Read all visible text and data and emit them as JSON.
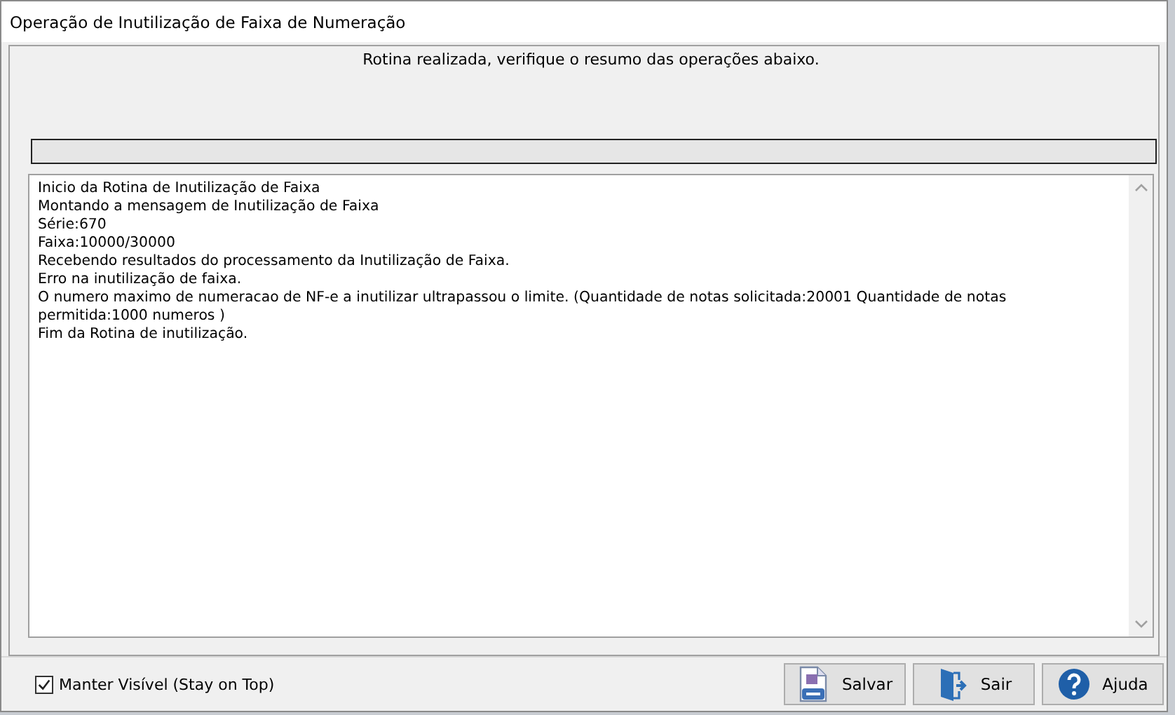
{
  "window": {
    "title": "Operação de Inutilização de Faixa de Numeração"
  },
  "status_message": "Rotina realizada, verifique o resumo das operações abaixo.",
  "progress": {
    "level": 0
  },
  "log_lines": [
    "Inicio da Rotina de Inutilização de Faixa",
    "Montando a mensagem de Inutilização de Faixa",
    "Série:670",
    "Faixa:10000/30000",
    "Recebendo resultados do processamento da Inutilização de Faixa.",
    "Erro na inutilização de faixa.",
    "O numero maximo de numeracao de NF-e a inutilizar ultrapassou o limite. (Quantidade de notas solicitada:20001 Quantidade de notas permitida:1000 numeros )",
    "Fim da Rotina de inutilização."
  ],
  "stay_on_top": {
    "label": "Manter Visível (Stay on Top)",
    "checked": true
  },
  "buttons": [
    {
      "kind": "save",
      "label": "Salvar"
    },
    {
      "kind": "exit",
      "label": "Sair"
    },
    {
      "kind": "help",
      "label": "Ajuda"
    }
  ]
}
